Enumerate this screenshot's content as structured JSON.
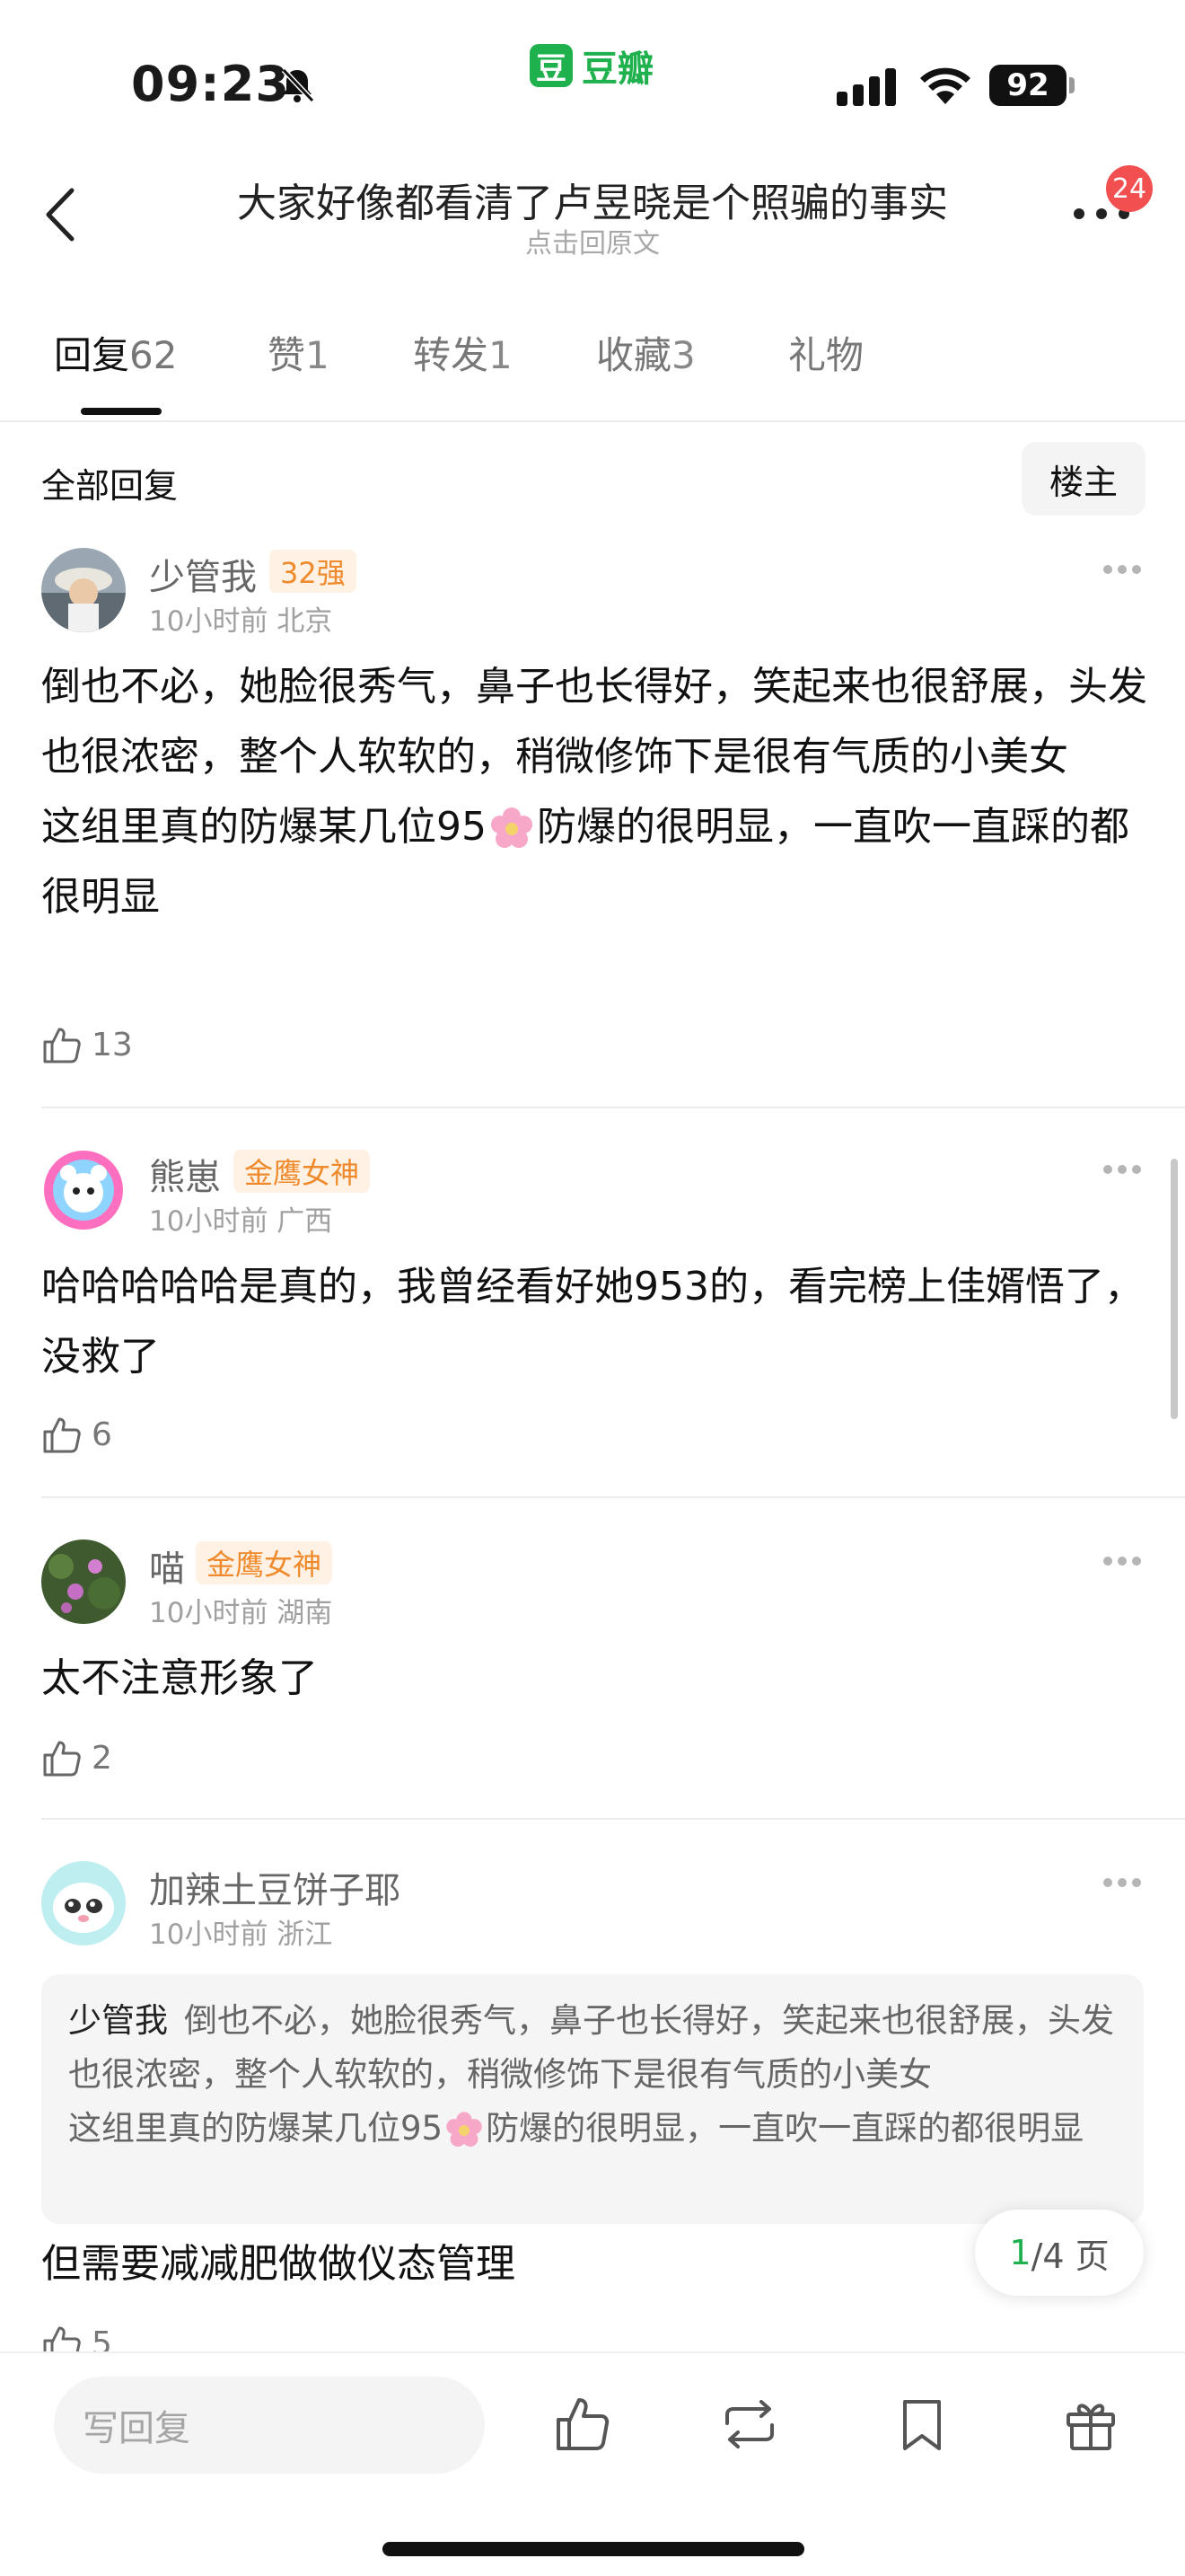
{
  "status_bar": {
    "time": "09:23",
    "battery": "92",
    "app_name": "豆瓣",
    "app_logo_char": "豆"
  },
  "header": {
    "title": "大家好像都看清了卢昱晓是个照骗的事实",
    "subtitle": "点击回原文",
    "notification_count": "24"
  },
  "tabs": [
    {
      "label": "回复",
      "count": "62"
    },
    {
      "label": "赞",
      "count": "1"
    },
    {
      "label": "转发",
      "count": "1"
    },
    {
      "label": "收藏",
      "count": "3"
    },
    {
      "label": "礼物",
      "count": ""
    }
  ],
  "section": {
    "title": "全部回复",
    "op_button": "楼主"
  },
  "comments": [
    {
      "username": "少管我",
      "badge": "32强",
      "meta": "10小时前 北京",
      "text_1": "倒也不必，她脸很秀气，鼻子也长得好，笑起来也很舒展，头发也很浓密，整个人软软的，稍微修饰下是很有气质的小美女",
      "text_2a": "这组里真的防爆某几位95",
      "text_2b": "防爆的很明显，一直吹一直踩的都很明显",
      "likes": "13"
    },
    {
      "username": "熊崽",
      "badge": "金鹰女神",
      "meta": "10小时前 广西",
      "text": "哈哈哈哈哈是真的，我曾经看好她953的，看完榜上佳婿悟了，没救了",
      "likes": "6"
    },
    {
      "username": "喵",
      "badge": "金鹰女神",
      "meta": "10小时前 湖南",
      "text": "太不注意形象了",
      "likes": "2"
    },
    {
      "username": "加辣土豆饼子耶",
      "badge": "",
      "meta": "10小时前 浙江",
      "quote_author": "少管我",
      "quote_text_1": "倒也不必，她脸很秀气，鼻子也长得好，笑起来也很舒展，头发也很浓密，整个人软软的，稍微修饰下是很有气质的小美女",
      "quote_text_2a": "这组里真的防爆某几位95",
      "quote_text_2b": "防爆的很明显，一直吹一直踩的都很明显",
      "text": "但需要减减肥做做仪态管理",
      "likes": "5"
    }
  ],
  "pagination": {
    "current": "1",
    "total_text": "/4 页"
  },
  "bottom_bar": {
    "reply_placeholder": "写回复"
  },
  "colors": {
    "brand_green": "#1fb14d",
    "badge_orange": "#ee8a2c",
    "badge_bg": "#fff2e4",
    "notif_red": "#f25050"
  }
}
